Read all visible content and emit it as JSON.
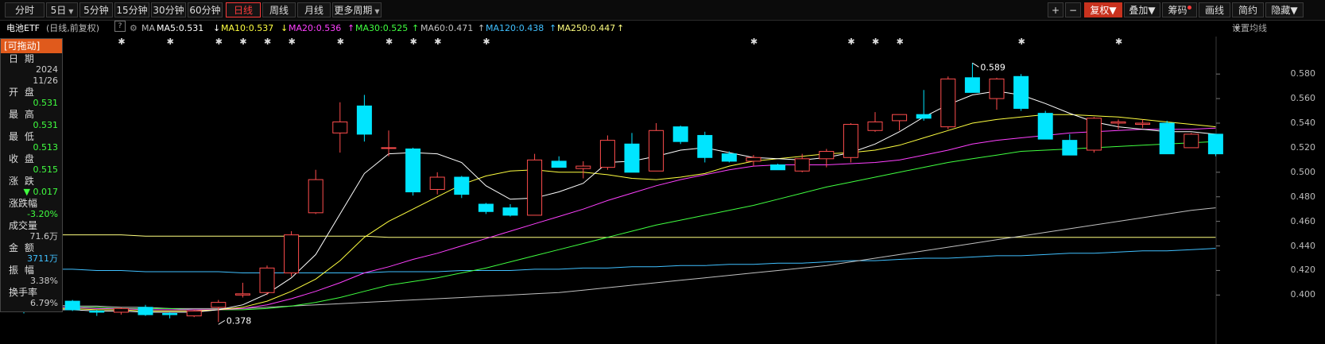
{
  "toolbar": {
    "tabs": [
      "分时",
      "5日",
      "5分钟",
      "15分钟",
      "30分钟",
      "60分钟",
      "日线",
      "周线",
      "月线",
      "更多周期"
    ],
    "active_tab": "日线",
    "right_buttons": [
      "+",
      "−",
      "复权",
      "叠加",
      "筹码",
      "画线",
      "简约",
      "隐藏"
    ]
  },
  "info": {
    "name": "电池ETF",
    "period": "(日线,前复权)",
    "help": "?",
    "ma_label": "MA",
    "ma5": "MA5:0.531",
    "ma10": "MA10:0.537",
    "ma20": "MA20:0.536",
    "ma30": "MA30:0.525",
    "ma60": "MA60:0.471",
    "ma120": "MA120:0.438",
    "ma250": "MA250:0.447",
    "settings": "设置均线"
  },
  "panel": {
    "header": "[可拖动]",
    "date_label": "日 期",
    "year": "2024",
    "date": "11/26",
    "open_label": "开 盘",
    "open": "0.531",
    "high_label": "最 高",
    "high": "0.531",
    "low_label": "最 低",
    "low": "0.513",
    "close_label": "收 盘",
    "close": "0.515",
    "change_label": "涨 跌",
    "change": "▼ 0.017",
    "pct_label": "涨跌幅",
    "pct": "-3.20%",
    "vol_label": "成交量",
    "vol": "71.6万",
    "amount_label": "金 额",
    "amount": "3711万",
    "amp_label": "振 幅",
    "amp": "3.38%",
    "turnover_label": "换手率",
    "turnover": "6.79%"
  },
  "annotations": {
    "max_label": "0.589",
    "min_label": "0.378"
  },
  "colors": {
    "up": "#ff4d4d",
    "down": "#00e5ff",
    "ma5": "#ffffff",
    "ma10": "#ffff40",
    "ma20": "#ff40ff",
    "ma30": "#40ff40",
    "ma60": "#c0c0c0",
    "ma120": "#40c0ff",
    "ma250": "#ffff80"
  },
  "chart_data": {
    "type": "candlestick",
    "ylim": [
      0.375,
      0.595
    ],
    "y_ticks": [
      "0.580",
      "0.560",
      "0.540",
      "0.520",
      "0.500",
      "0.480",
      "0.460",
      "0.440",
      "0.420",
      "0.400"
    ],
    "y_tick_values": [
      0.58,
      0.56,
      0.54,
      0.52,
      0.5,
      0.48,
      0.46,
      0.44,
      0.42,
      0.4
    ],
    "candles": [
      [
        0.388,
        0.39,
        0.385,
        0.387
      ],
      [
        0.39,
        0.392,
        0.386,
        0.389
      ],
      [
        0.395,
        0.396,
        0.387,
        0.388
      ],
      [
        0.387,
        0.388,
        0.383,
        0.386
      ],
      [
        0.386,
        0.39,
        0.384,
        0.389
      ],
      [
        0.39,
        0.392,
        0.383,
        0.384
      ],
      [
        0.385,
        0.386,
        0.381,
        0.384
      ],
      [
        0.383,
        0.388,
        0.382,
        0.387
      ],
      [
        0.39,
        0.396,
        0.378,
        0.394
      ],
      [
        0.4,
        0.41,
        0.398,
        0.401
      ],
      [
        0.402,
        0.424,
        0.4,
        0.422
      ],
      [
        0.418,
        0.452,
        0.415,
        0.449
      ],
      [
        0.467,
        0.502,
        0.466,
        0.494
      ],
      [
        0.532,
        0.557,
        0.516,
        0.541
      ],
      [
        0.554,
        0.563,
        0.525,
        0.531
      ],
      [
        0.52,
        0.534,
        0.513,
        0.52
      ],
      [
        0.519,
        0.52,
        0.481,
        0.484
      ],
      [
        0.486,
        0.5,
        0.482,
        0.496
      ],
      [
        0.496,
        0.497,
        0.479,
        0.482
      ],
      [
        0.474,
        0.475,
        0.466,
        0.468
      ],
      [
        0.471,
        0.474,
        0.464,
        0.465
      ],
      [
        0.465,
        0.515,
        0.465,
        0.51
      ],
      [
        0.509,
        0.513,
        0.504,
        0.504
      ],
      [
        0.503,
        0.509,
        0.495,
        0.505
      ],
      [
        0.504,
        0.53,
        0.502,
        0.526
      ],
      [
        0.523,
        0.532,
        0.5,
        0.5
      ],
      [
        0.501,
        0.54,
        0.501,
        0.534
      ],
      [
        0.537,
        0.538,
        0.523,
        0.525
      ],
      [
        0.53,
        0.533,
        0.508,
        0.512
      ],
      [
        0.515,
        0.517,
        0.508,
        0.509
      ],
      [
        0.509,
        0.514,
        0.505,
        0.512
      ],
      [
        0.506,
        0.507,
        0.502,
        0.502
      ],
      [
        0.501,
        0.515,
        0.5,
        0.511
      ],
      [
        0.511,
        0.519,
        0.504,
        0.517
      ],
      [
        0.512,
        0.54,
        0.508,
        0.539
      ],
      [
        0.534,
        0.549,
        0.533,
        0.541
      ],
      [
        0.542,
        0.547,
        0.534,
        0.547
      ],
      [
        0.547,
        0.567,
        0.542,
        0.544
      ],
      [
        0.537,
        0.578,
        0.535,
        0.576
      ],
      [
        0.577,
        0.589,
        0.568,
        0.565
      ],
      [
        0.56,
        0.577,
        0.551,
        0.576
      ],
      [
        0.578,
        0.58,
        0.55,
        0.552
      ],
      [
        0.548,
        0.55,
        0.53,
        0.527
      ],
      [
        0.526,
        0.531,
        0.518,
        0.514
      ],
      [
        0.518,
        0.545,
        0.516,
        0.544
      ],
      [
        0.54,
        0.543,
        0.535,
        0.541
      ],
      [
        0.539,
        0.543,
        0.536,
        0.54
      ],
      [
        0.54,
        0.542,
        0.52,
        0.515
      ],
      [
        0.52,
        0.532,
        0.52,
        0.531
      ],
      [
        0.531,
        0.531,
        0.513,
        0.515
      ]
    ],
    "ma5": [
      0.388,
      0.388,
      0.388,
      0.387,
      0.387,
      0.386,
      0.386,
      0.386,
      0.388,
      0.392,
      0.401,
      0.414,
      0.433,
      0.466,
      0.499,
      0.515,
      0.516,
      0.515,
      0.508,
      0.489,
      0.478,
      0.479,
      0.484,
      0.491,
      0.508,
      0.509,
      0.513,
      0.518,
      0.52,
      0.516,
      0.512,
      0.511,
      0.51,
      0.512,
      0.516,
      0.523,
      0.533,
      0.545,
      0.555,
      0.563,
      0.566,
      0.563,
      0.556,
      0.548,
      0.541,
      0.537,
      0.535,
      0.533,
      0.533,
      0.531
    ],
    "ma10": [
      0.389,
      0.389,
      0.389,
      0.388,
      0.388,
      0.387,
      0.387,
      0.387,
      0.388,
      0.39,
      0.395,
      0.403,
      0.413,
      0.428,
      0.447,
      0.46,
      0.47,
      0.48,
      0.49,
      0.497,
      0.501,
      0.502,
      0.5,
      0.5,
      0.498,
      0.495,
      0.494,
      0.496,
      0.499,
      0.505,
      0.509,
      0.511,
      0.513,
      0.515,
      0.516,
      0.518,
      0.522,
      0.528,
      0.534,
      0.54,
      0.543,
      0.545,
      0.547,
      0.547,
      0.546,
      0.545,
      0.543,
      0.541,
      0.539,
      0.537
    ],
    "ma20": [
      0.39,
      0.39,
      0.39,
      0.389,
      0.389,
      0.388,
      0.388,
      0.388,
      0.388,
      0.389,
      0.392,
      0.397,
      0.403,
      0.41,
      0.418,
      0.423,
      0.429,
      0.434,
      0.44,
      0.446,
      0.452,
      0.458,
      0.464,
      0.47,
      0.477,
      0.483,
      0.489,
      0.494,
      0.498,
      0.502,
      0.505,
      0.506,
      0.506,
      0.506,
      0.507,
      0.508,
      0.51,
      0.514,
      0.518,
      0.523,
      0.526,
      0.528,
      0.53,
      0.532,
      0.533,
      0.534,
      0.535,
      0.535,
      0.535,
      0.536
    ],
    "ma30": [
      0.39,
      0.39,
      0.39,
      0.39,
      0.389,
      0.389,
      0.389,
      0.388,
      0.388,
      0.388,
      0.389,
      0.391,
      0.394,
      0.398,
      0.403,
      0.408,
      0.411,
      0.414,
      0.418,
      0.422,
      0.427,
      0.432,
      0.437,
      0.442,
      0.447,
      0.452,
      0.457,
      0.461,
      0.465,
      0.469,
      0.473,
      0.478,
      0.483,
      0.488,
      0.492,
      0.496,
      0.5,
      0.504,
      0.508,
      0.511,
      0.514,
      0.517,
      0.518,
      0.519,
      0.52,
      0.521,
      0.522,
      0.523,
      0.524,
      0.525
    ],
    "ma60": [
      0.392,
      0.392,
      0.391,
      0.391,
      0.39,
      0.39,
      0.389,
      0.389,
      0.389,
      0.389,
      0.39,
      0.391,
      0.392,
      0.393,
      0.394,
      0.395,
      0.396,
      0.397,
      0.398,
      0.399,
      0.4,
      0.401,
      0.402,
      0.404,
      0.406,
      0.408,
      0.41,
      0.412,
      0.414,
      0.416,
      0.418,
      0.42,
      0.422,
      0.424,
      0.427,
      0.43,
      0.433,
      0.436,
      0.439,
      0.442,
      0.445,
      0.448,
      0.451,
      0.454,
      0.457,
      0.46,
      0.463,
      0.466,
      0.469,
      0.471
    ],
    "ma120": [
      0.422,
      0.421,
      0.421,
      0.42,
      0.42,
      0.419,
      0.419,
      0.419,
      0.419,
      0.418,
      0.418,
      0.418,
      0.418,
      0.418,
      0.418,
      0.419,
      0.419,
      0.419,
      0.42,
      0.42,
      0.42,
      0.421,
      0.421,
      0.422,
      0.422,
      0.423,
      0.423,
      0.424,
      0.424,
      0.425,
      0.425,
      0.426,
      0.426,
      0.427,
      0.428,
      0.428,
      0.429,
      0.43,
      0.43,
      0.431,
      0.432,
      0.432,
      0.433,
      0.434,
      0.434,
      0.435,
      0.436,
      0.436,
      0.437,
      0.438
    ],
    "ma250": [
      0.449,
      0.449,
      0.449,
      0.449,
      0.449,
      0.448,
      0.448,
      0.448,
      0.448,
      0.448,
      0.448,
      0.448,
      0.448,
      0.448,
      0.448,
      0.447,
      0.447,
      0.447,
      0.447,
      0.447,
      0.447,
      0.447,
      0.447,
      0.447,
      0.447,
      0.447,
      0.447,
      0.447,
      0.447,
      0.447,
      0.447,
      0.447,
      0.447,
      0.447,
      0.447,
      0.447,
      0.447,
      0.447,
      0.447,
      0.447,
      0.447,
      0.447,
      0.447,
      0.447,
      0.447,
      0.447,
      0.447,
      0.447,
      0.447,
      0.447
    ],
    "star_marks": [
      4,
      6,
      8,
      9,
      10,
      11,
      13,
      15,
      16,
      17,
      19,
      30,
      34,
      35,
      36,
      41,
      45
    ]
  }
}
